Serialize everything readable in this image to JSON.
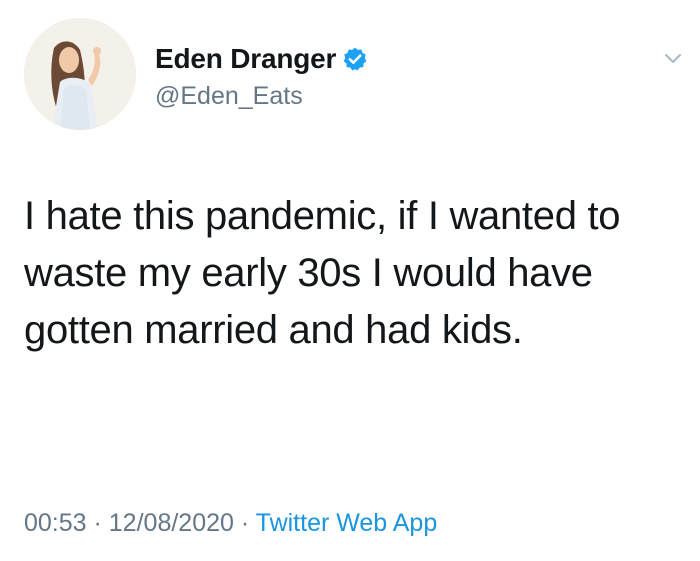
{
  "tweet": {
    "display_name": "Eden Dranger",
    "handle": "@Eden_Eats",
    "verified": true,
    "text": "I hate this pandemic, if I wanted to waste my early 30s I would have gotten married and had kids.",
    "time": "00:53",
    "date": "12/08/2020",
    "source": "Twitter Web App",
    "separator": " · "
  },
  "icons": {
    "verified": "verified-badge-icon",
    "caret": "chevron-down-icon"
  },
  "colors": {
    "text": "#14171a",
    "secondary": "#657786",
    "link": "#1b95e0",
    "verified": "#1da1f2"
  }
}
